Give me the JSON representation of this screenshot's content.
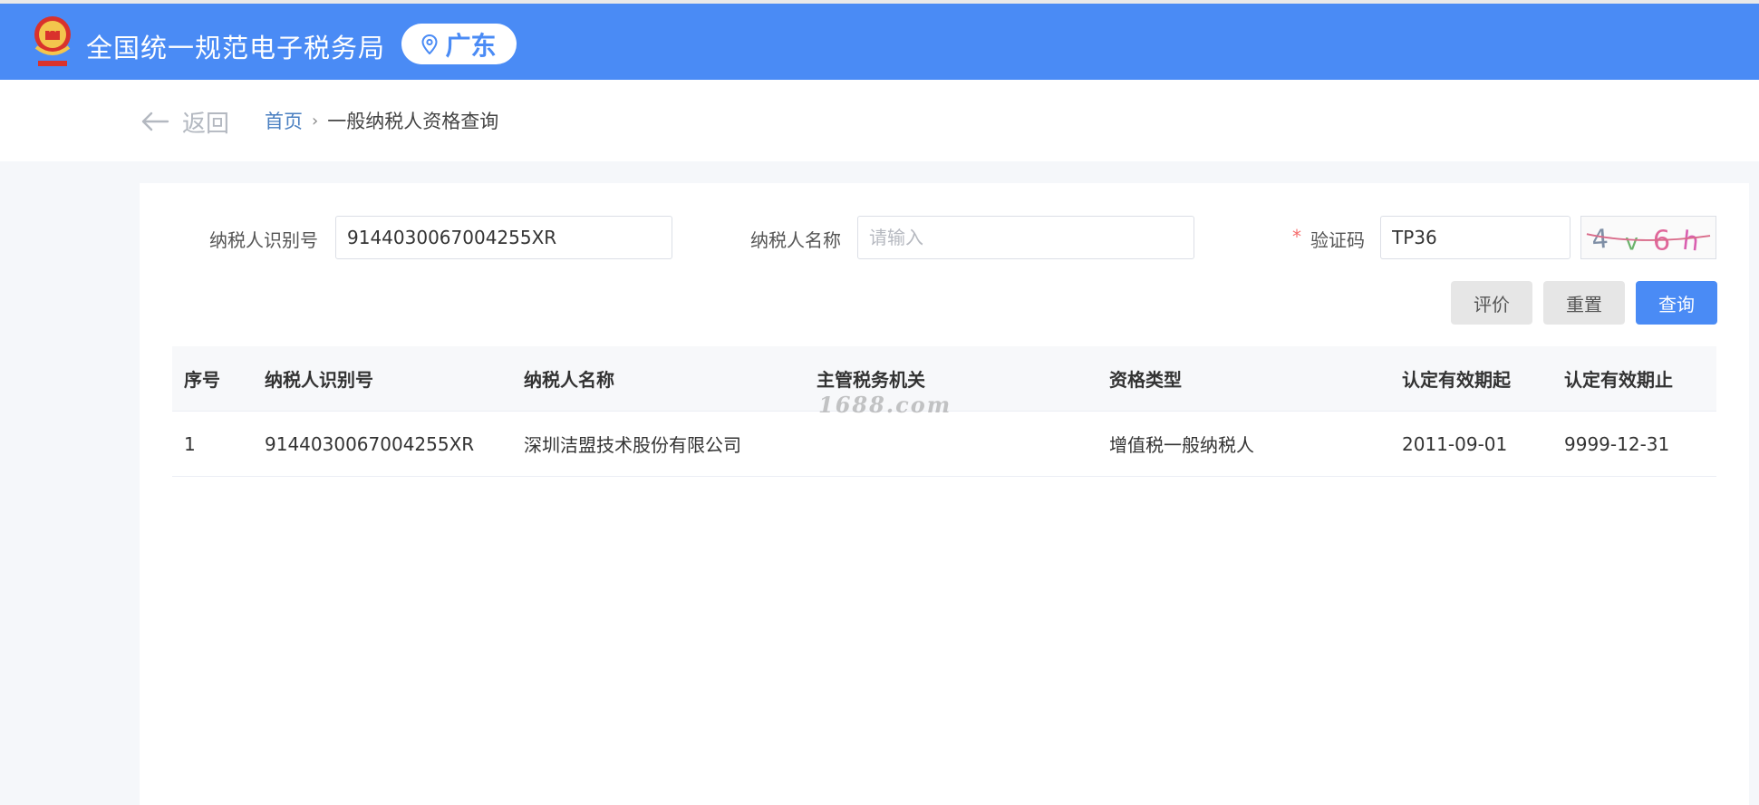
{
  "header": {
    "site_title": "全国统一规范电子税务局",
    "region": "广东",
    "emblem_icon": "national-emblem-icon",
    "location_icon": "location-pin-icon",
    "bg_color": "#4a8bf5"
  },
  "nav": {
    "back_label": "返回",
    "back_icon": "arrow-left-icon",
    "breadcrumb_home": "首页",
    "breadcrumb_sep": "›",
    "breadcrumb_current": "一般纳税人资格查询"
  },
  "form": {
    "taxpayer_id_label": "纳税人识别号",
    "taxpayer_id_value": "9144030067004255XR",
    "taxpayer_name_label": "纳税人名称",
    "taxpayer_name_placeholder": "请输入",
    "captcha_label": "验证码",
    "captcha_required_mark": "*",
    "captcha_value": "TP36",
    "captcha_image_text": "4v6h"
  },
  "buttons": {
    "evaluate": "评价",
    "reset": "重置",
    "query": "查询"
  },
  "table": {
    "columns": [
      "序号",
      "纳税人识别号",
      "纳税人名称",
      "主管税务机关",
      "资格类型",
      "认定有效期起",
      "认定有效期止"
    ],
    "rows": [
      [
        "1",
        "9144030067004255XR",
        "深圳洁盟技术股份有限公司",
        "",
        "增值税一般纳税人",
        "2011-09-01",
        "9999-12-31"
      ]
    ]
  },
  "watermark": "1688.com"
}
